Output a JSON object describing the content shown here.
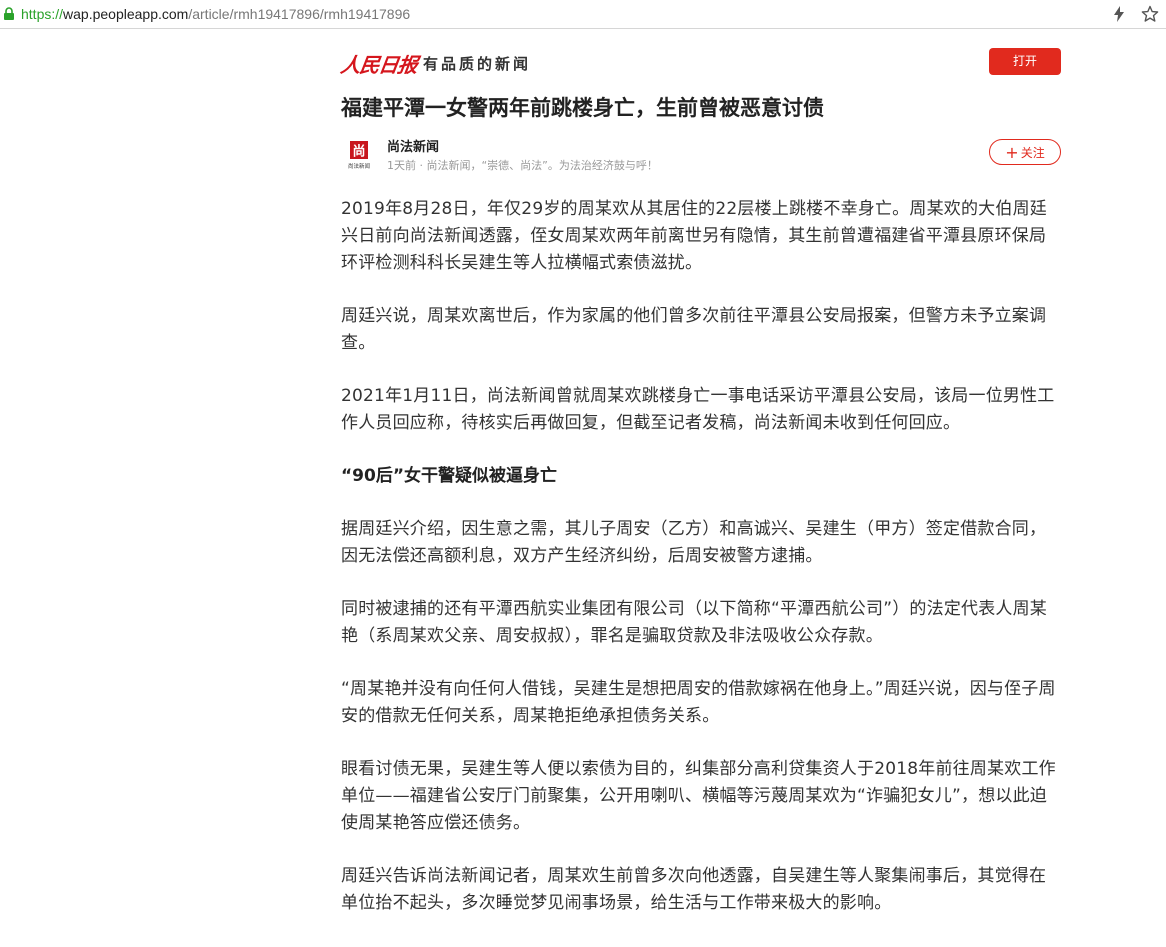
{
  "browser": {
    "url_scheme": "https://",
    "url_host": "wap.peopleapp.com",
    "url_path": "/article/rmh19417896/rmh19417896"
  },
  "header": {
    "logo_text": "人民日报",
    "slogan": "有品质的新闻",
    "open_button": "打开"
  },
  "article": {
    "title": "福建平潭一女警两年前跳楼身亡，生前曾被恶意讨债",
    "author": {
      "name": "尚法新闻",
      "meta": "1天前 · 尚法新闻，“崇德、尚法”。为法治经济鼓与呼！",
      "avatar_char": "尚",
      "avatar_caption": "尚法新闻",
      "follow_label": "关注"
    },
    "paragraphs": [
      "2019年8月28日，年仅29岁的周某欢从其居住的22层楼上跳楼不幸身亡。周某欢的大伯周廷兴日前向尚法新闻透露，侄女周某欢两年前离世另有隐情，其生前曾遭福建省平潭县原环保局环评检测科科长吴建生等人拉横幅式索债滋扰。",
      "周廷兴说，周某欢离世后，作为家属的他们曾多次前往平潭县公安局报案，但警方未予立案调查。",
      "2021年1月11日，尚法新闻曾就周某欢跳楼身亡一事电话采访平潭县公安局，该局一位男性工作人员回应称，待核实后再做回复，但截至记者发稿，尚法新闻未收到任何回应。"
    ],
    "subheading": "“90后”女干警疑似被逼身亡",
    "paragraphs2": [
      "据周廷兴介绍，因生意之需，其儿子周安（乙方）和高诚兴、吴建生（甲方）签定借款合同，因无法偿还高额利息，双方产生经济纠纷，后周安被警方逮捕。",
      "同时被逮捕的还有平潭西航实业集团有限公司（以下简称“平潭西航公司”）的法定代表人周某艳（系周某欢父亲、周安叔叔），罪名是骗取贷款及非法吸收公众存款。",
      "“周某艳并没有向任何人借钱，吴建生是想把周安的借款嫁祸在他身上。”周廷兴说，因与侄子周安的借款无任何关系，周某艳拒绝承担债务关系。",
      "眼看讨债无果，吴建生等人便以索债为目的，纠集部分高利贷集资人于2018年前往周某欢工作单位——福建省公安厅门前聚集，公开用喇叭、横幅等污蔑周某欢为“诈骗犯女儿”，想以此迫使周某艳答应偿还债务。",
      "周廷兴告诉尚法新闻记者，周某欢生前曾多次向他透露，自吴建生等人聚集闹事后，其觉得在单位抬不起头，多次睡觉梦见闹事场景，给生活与工作带来极大的影响。"
    ]
  },
  "colors": {
    "brand_red": "#e12a1e",
    "url_green": "#2aa22a"
  }
}
